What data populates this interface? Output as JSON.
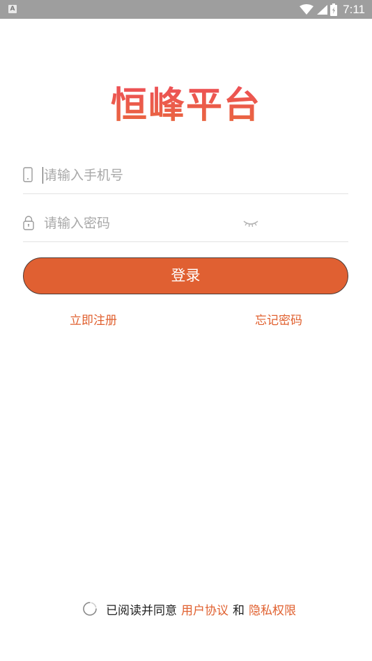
{
  "status_bar": {
    "left_badge": "A",
    "time": "7:11",
    "icons": [
      "wifi-icon",
      "signal-icon",
      "battery-icon"
    ]
  },
  "app": {
    "title": "恒峰平台"
  },
  "login_form": {
    "phone_placeholder": "请输入手机号",
    "phone_value": "",
    "password_placeholder": "请输入密码",
    "password_value": "",
    "login_label": "登录",
    "register_label": "立即注册",
    "forgot_label": "忘记密码"
  },
  "agreement": {
    "prefix": "已阅读并同意",
    "user_agreement": "用户协议",
    "conjunction": "和",
    "privacy": "隐私权限"
  },
  "colors": {
    "accent": "#e0602f",
    "title_gradient_top": "#ee4d5a",
    "title_gradient_bottom": "#e86b3a",
    "status_bar": "#9e9e9e"
  }
}
